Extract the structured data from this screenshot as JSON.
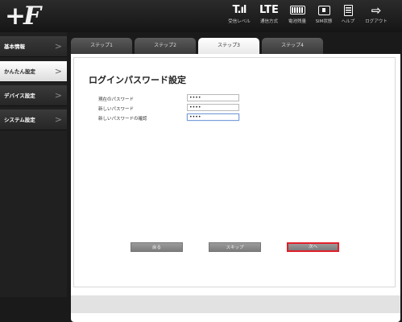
{
  "header": {
    "logo_text": "+F",
    "status_icons": [
      {
        "icon": "signal-icon",
        "glyph": "T.ıl",
        "label": "受信レベル"
      },
      {
        "icon": "network-type-icon",
        "glyph": "LTE",
        "label": "通信方式"
      },
      {
        "icon": "battery-icon",
        "glyph": "",
        "label": "電池残量"
      },
      {
        "icon": "sim-icon",
        "glyph": "",
        "label": "SIM状態"
      },
      {
        "icon": "help-icon",
        "glyph": "",
        "label": "ヘルプ"
      },
      {
        "icon": "logout-icon",
        "glyph": "⇨",
        "label": "ログアウト"
      }
    ]
  },
  "sidebar": {
    "items": [
      {
        "label": "基本情報",
        "active": false
      },
      {
        "label": "かんたん設定",
        "active": true
      },
      {
        "label": "デバイス設定",
        "active": false
      },
      {
        "label": "システム設定",
        "active": false
      }
    ],
    "chevron": ">"
  },
  "tabs": [
    {
      "label": "ステップ1",
      "active": false
    },
    {
      "label": "ステップ2",
      "active": false
    },
    {
      "label": "ステップ3",
      "active": true
    },
    {
      "label": "ステップ4",
      "active": false
    }
  ],
  "form": {
    "title": "ログインパスワード設定",
    "fields": [
      {
        "label": "現在のパスワード",
        "value": "••••"
      },
      {
        "label": "新しいパスワード",
        "value": "••••"
      },
      {
        "label": "新しいパスワードの確認",
        "value": "••••"
      }
    ]
  },
  "buttons": {
    "back": "戻る",
    "skip": "スキップ",
    "next": "次へ"
  },
  "colors": {
    "accent_red": "#e0202a",
    "focus_blue": "#7a9fd8",
    "background_dark": "#1a1a1a"
  }
}
